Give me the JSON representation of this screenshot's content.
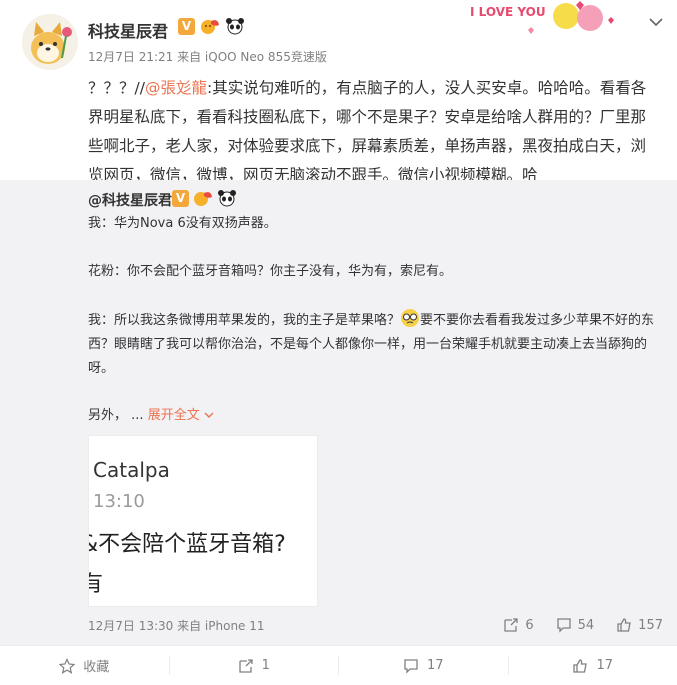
{
  "post": {
    "username": "科技星辰君",
    "meta": "12月7日 21:21 来自 iQOO Neo 855竞速版",
    "text_prefix": "？？？//",
    "mention": "@張彣龍",
    "text_body": ":其实说句难听的，有点脑子的人，没人买安卓。哈哈哈。看看各界明星私底下，看看科技圈私底下，哪个不是果子？安卓是给啥人群用的？厂里那些啊北子，老人家，对体验要求底下，屏幕素质差，单扬声器，黑夜拍成白天，浏览网页，微信，微博，网页无脑滚动不跟手。微信小视频模糊。哈",
    "love_text": "I LOVE YOU"
  },
  "repost": {
    "username": "@科技星辰君",
    "line1": "我：华为Nova 6没有双扬声器。",
    "line2": "花粉：你不会配个蓝牙音箱吗？你主子没有，华为有，索尼有。",
    "line3a": "我：所以我这条微博用苹果发的，我的主子是苹果咯？",
    "line3b": "要不要你去看看我发过多少苹果不好的东西？眼睛瞎了我可以帮你治治，不是每个人都像你一样，用一台荣耀手机就要主动凑上去当舔狗的呀。",
    "line4_prefix": "另外，",
    "line4_ellipsis": " ... ",
    "expand_label": "展开全文",
    "image": {
      "line1": "Catalpa",
      "line2": "13:10",
      "line3": "&不会陪个蓝牙音箱?",
      "line4": "有"
    },
    "footer_meta": "12月7日 13:30 来自 iPhone 11",
    "repost_count": "6",
    "comment_count": "54",
    "like_count": "157"
  },
  "bottom": {
    "favorite_label": "收藏",
    "repost_count": "1",
    "comment_count": "17",
    "like_count": "17"
  },
  "colors": {
    "accent": "#eb7350",
    "muted": "#808080",
    "repost_bg": "#f2f2f5",
    "vip_badge": "#f4a73a"
  }
}
